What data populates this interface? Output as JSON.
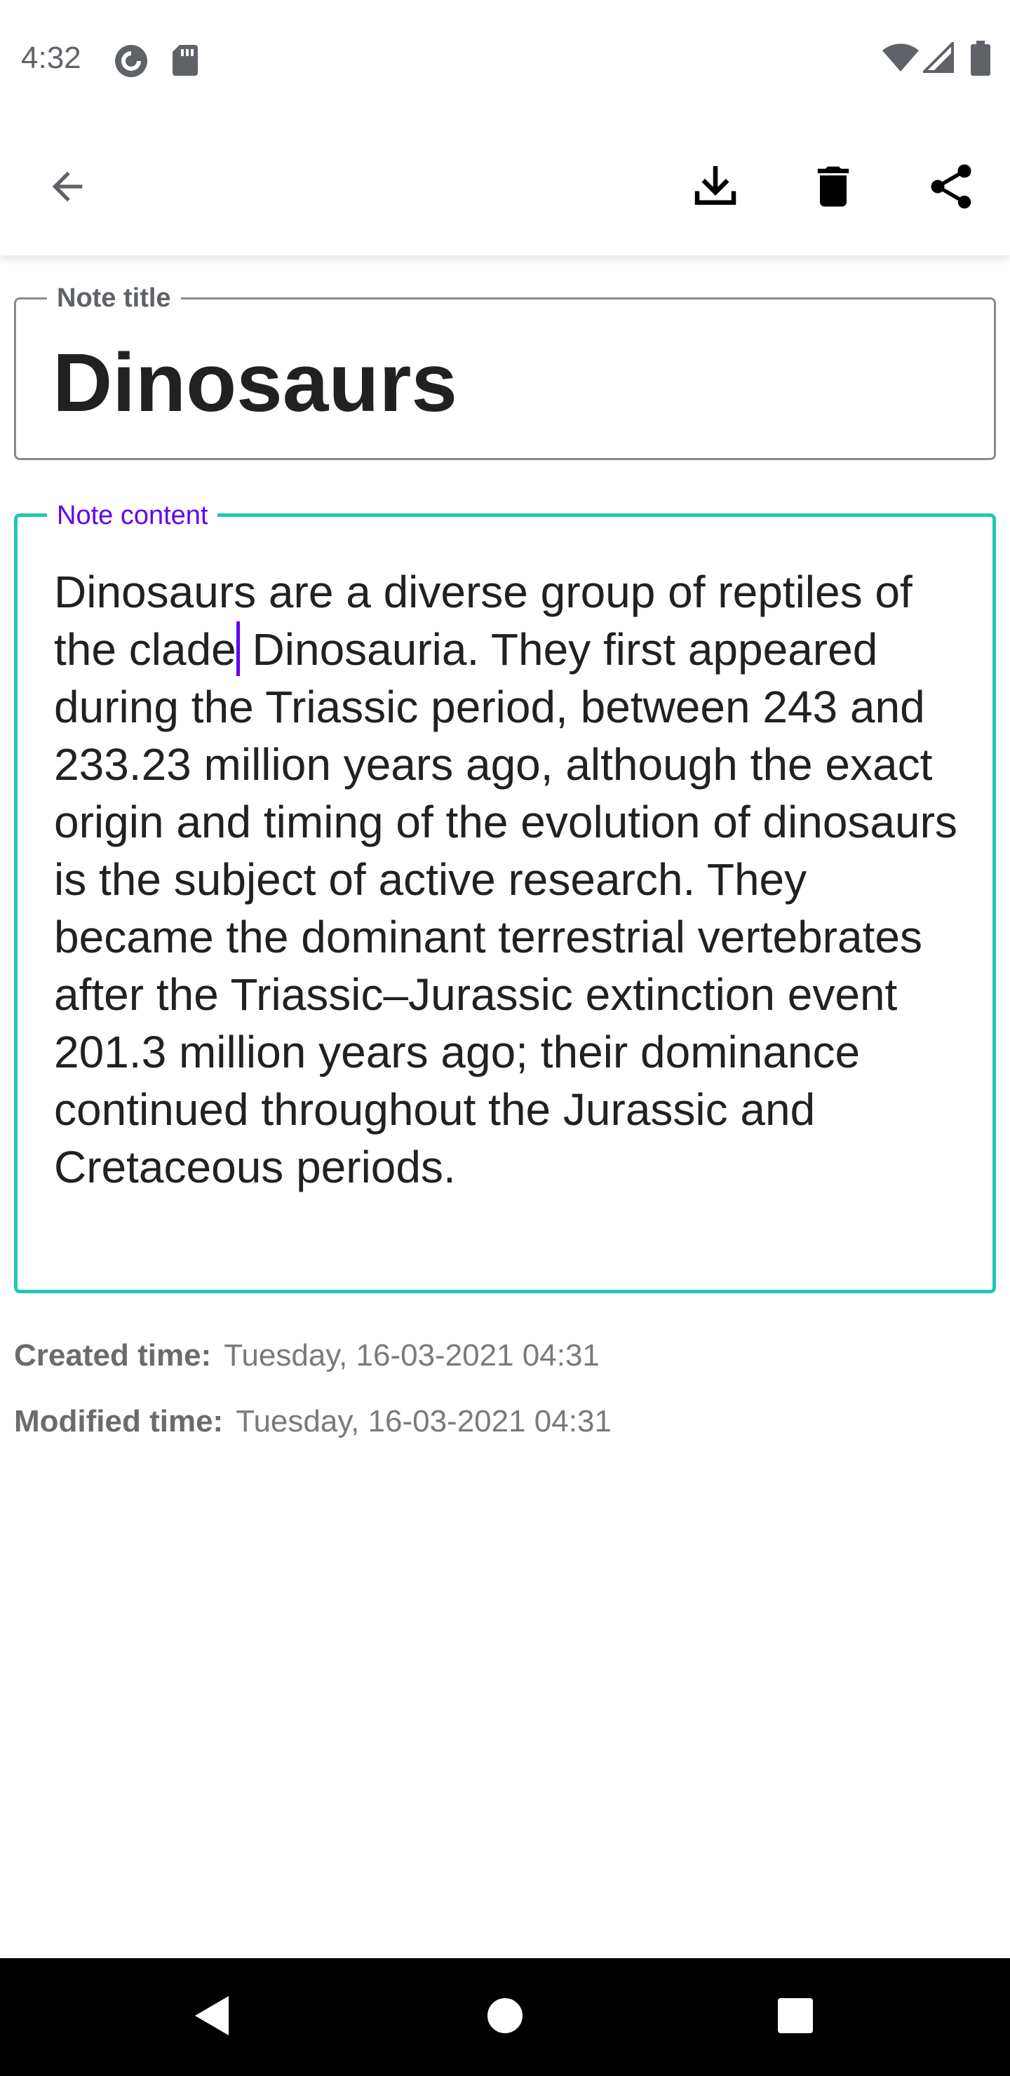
{
  "status_bar": {
    "time": "4:32",
    "left_icons": [
      "pocket-casts-icon",
      "sd-card-icon"
    ],
    "right_icons": [
      "wifi-icon",
      "cell-signal-icon",
      "battery-icon"
    ]
  },
  "app_bar": {
    "back_icon": "arrow-back-icon",
    "actions": [
      "download-icon",
      "delete-icon",
      "share-icon"
    ]
  },
  "note": {
    "title_label": "Note title",
    "title_value": "Dinosaurs",
    "content_label": "Note content",
    "content_before_cursor": "Dinosaurs are a diverse group of reptiles of the clade",
    "content_after_cursor": " Dinosauria. They first appeared during the Triassic period, between 243 and 233.23 million years ago, although the exact origin and timing of the evolution of dinosaurs is the subject of active research. They became the dominant terrestrial vertebrates after the Triassic–Jurassic extinction event 201.3 million years ago; their dominance continued throughout the Jurassic and Cretaceous periods."
  },
  "meta": {
    "created_label": "Created time:",
    "created_value": "Tuesday, 16-03-2021 04:31",
    "modified_label": "Modified time:",
    "modified_value": "Tuesday, 16-03-2021 04:31"
  },
  "colors": {
    "accent": "#6200ee",
    "focus_border": "#1fc8b4",
    "text_primary": "#212121",
    "text_secondary": "#7a7a7a"
  },
  "nav_bar": {
    "buttons": [
      "nav-back-icon",
      "nav-home-icon",
      "nav-recents-icon"
    ]
  }
}
